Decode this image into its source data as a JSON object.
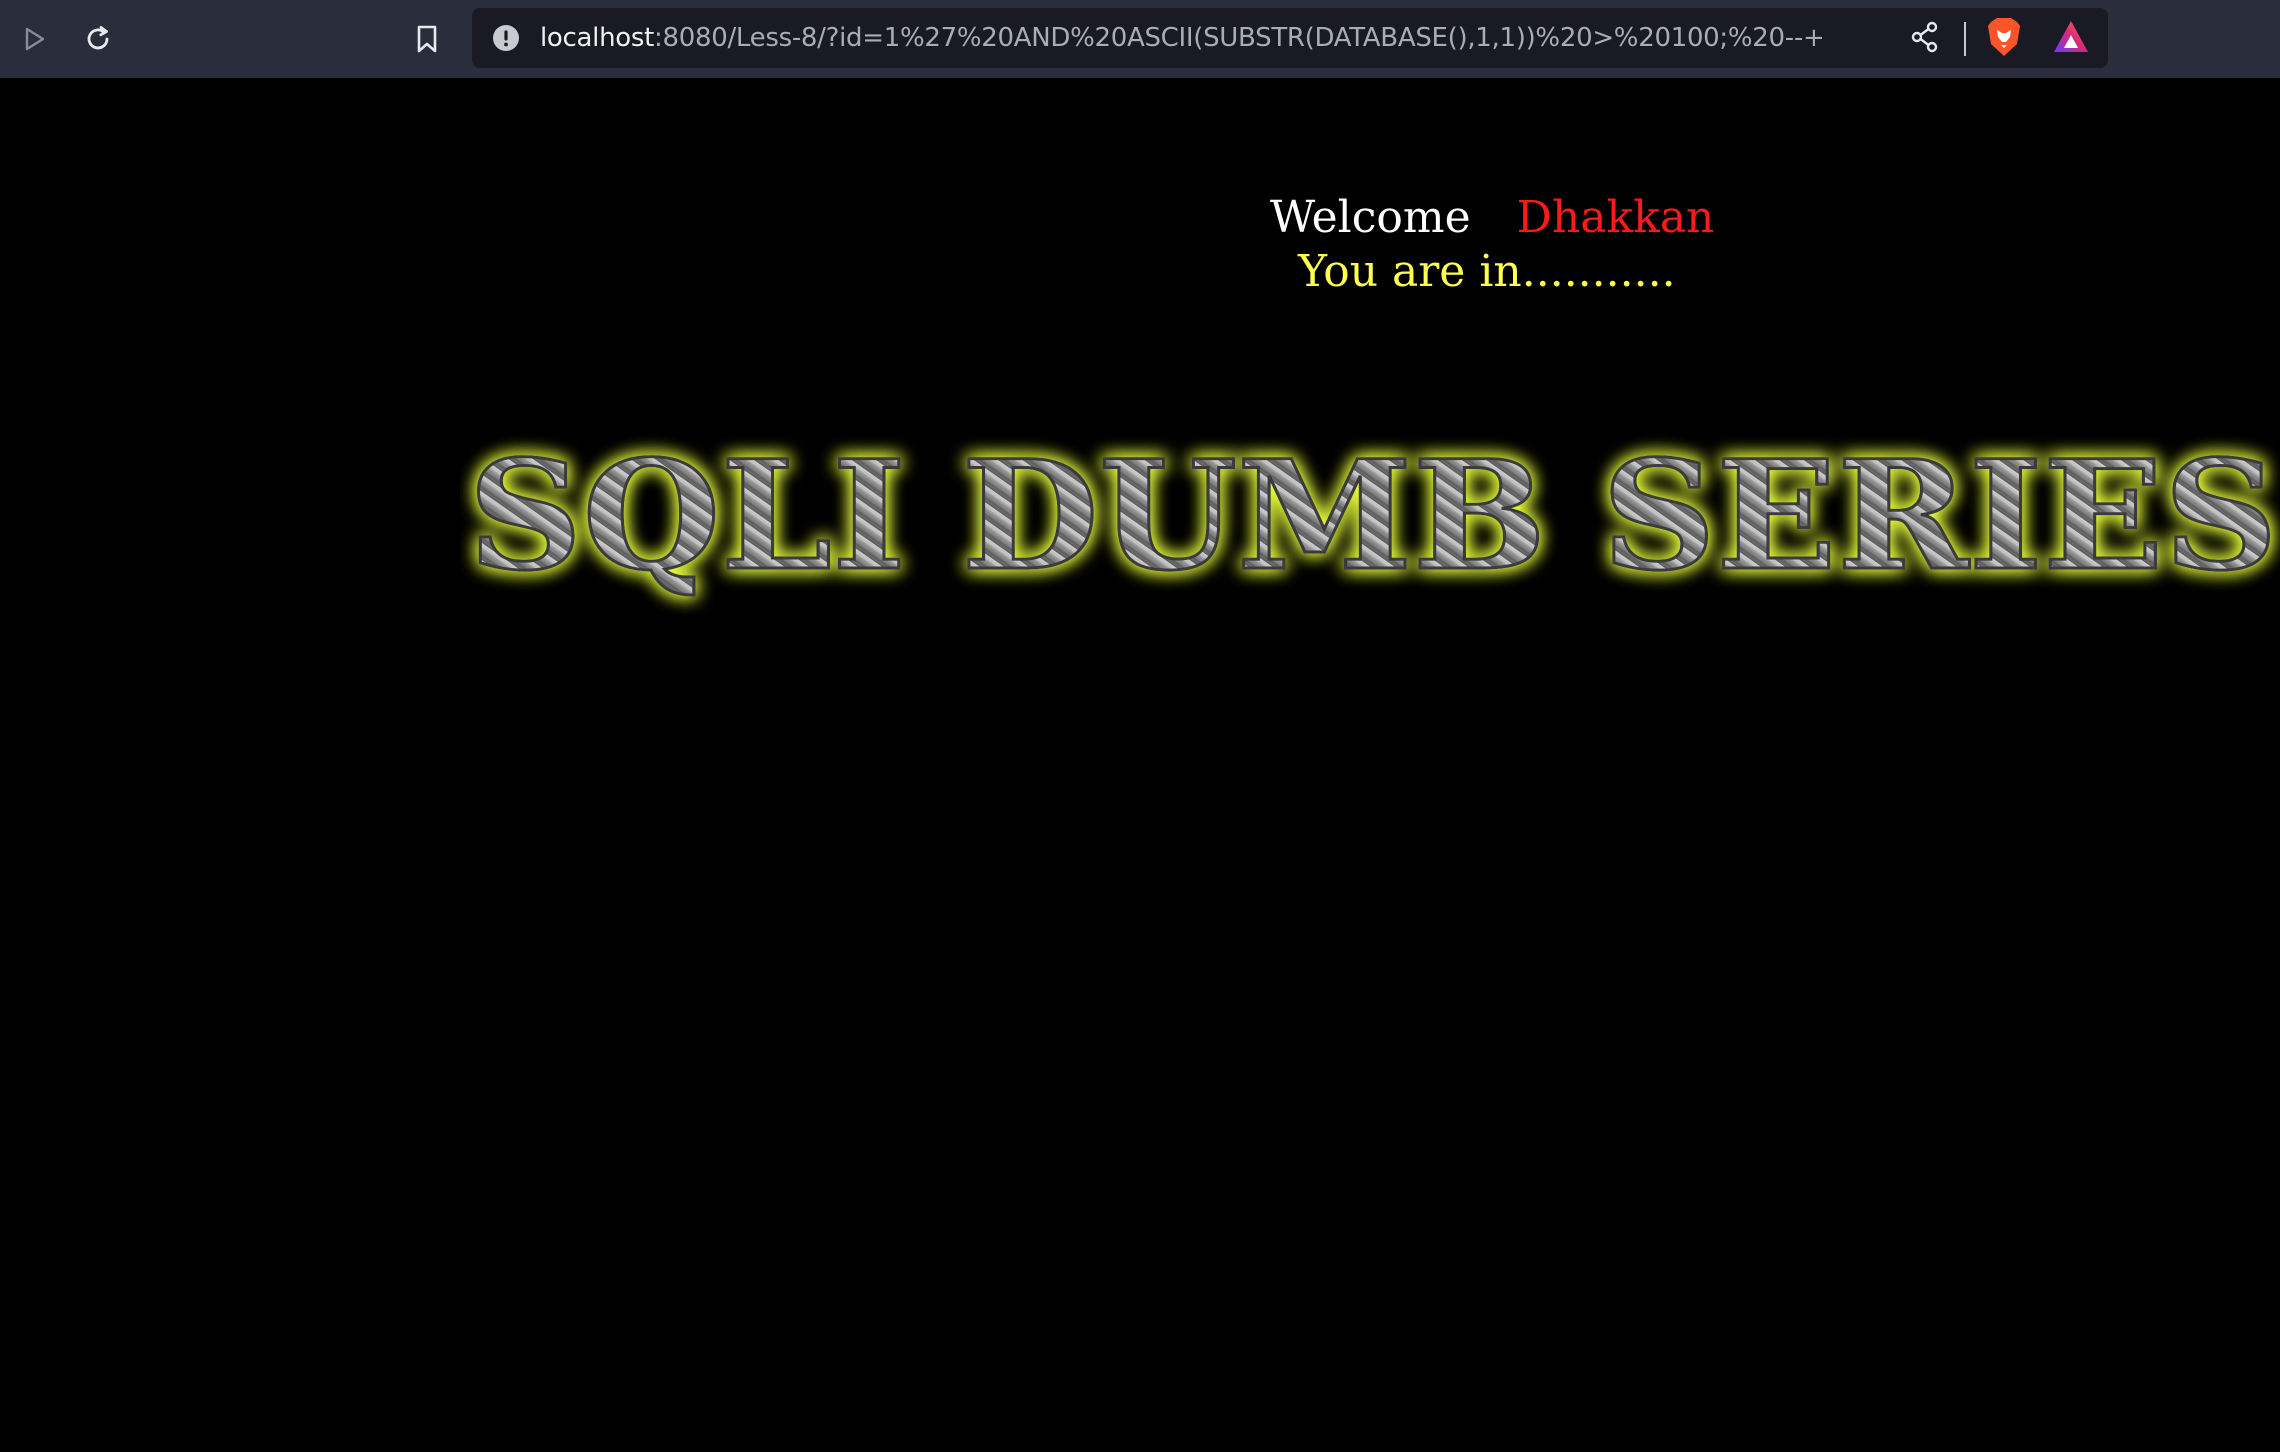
{
  "browser": {
    "url_host": "localhost",
    "url_rest": ":8080/Less-8/?id=1%27%20AND%20ASCII(SUBSTR(DATABASE(),1,1))%20>%20100;%20--+",
    "icons": {
      "play": "play-icon",
      "reload": "reload-icon",
      "bookmark": "bookmark-icon",
      "info": "info-icon",
      "share": "share-icon",
      "brave": "brave-lion-icon",
      "rewards": "brave-rewards-icon"
    }
  },
  "page": {
    "welcome_label": "Welcome",
    "user_name": "Dhakkan",
    "status_message": "You are in...........",
    "banner_text": "SQLI DUMB SERIES",
    "colors": {
      "background": "#000000",
      "welcome": "#ffffff",
      "user_name": "#ff1a1a",
      "status": "#ffff4d",
      "banner_glow": "#e8ff3a"
    }
  }
}
